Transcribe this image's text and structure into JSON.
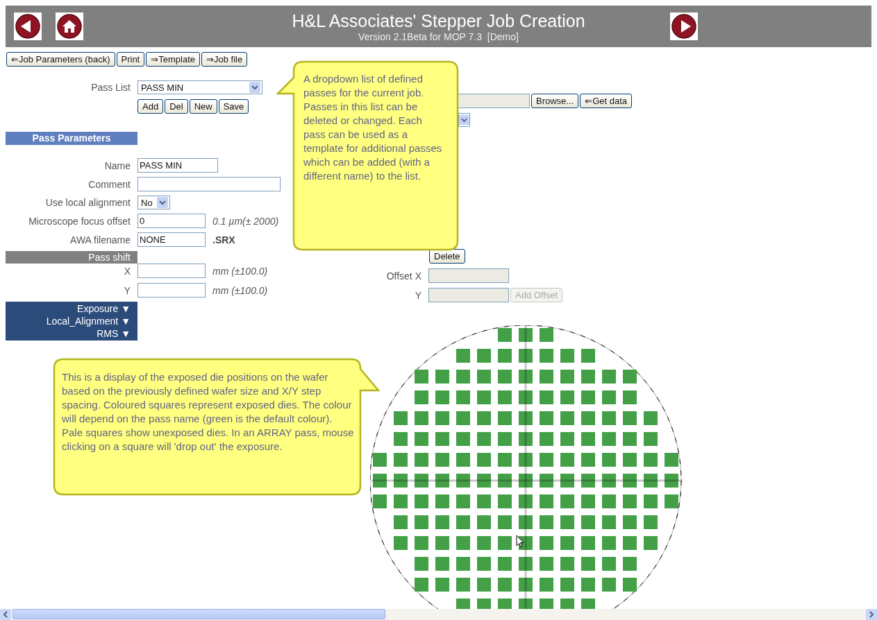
{
  "header": {
    "title": "H&L Associates' Stepper Job Creation",
    "subtitle": "Version 2.1Beta for MOP 7.3  [Demo]"
  },
  "toolbar": [
    "⇐Job Parameters (back)",
    "Print",
    "⇒Template",
    "⇒Job file"
  ],
  "pass_list": {
    "label": "Pass List",
    "value": "PASS MIN",
    "buttons": [
      "Add",
      "Del",
      "New",
      "Save"
    ]
  },
  "pass_parameters": {
    "title": "Pass Parameters",
    "fields": [
      {
        "label": "Name",
        "kind": "text",
        "value": "PASS MIN"
      },
      {
        "label": "Comment",
        "kind": "text"
      },
      {
        "label": "Use local alignment",
        "kind": "select",
        "value": "No"
      },
      {
        "label": "Microscope focus offset",
        "kind": "text",
        "value": "0",
        "unit": {
          "text": "0.1 µm(± 2000)",
          "kind": "note"
        }
      },
      {
        "label": "AWA filename",
        "kind": "text",
        "value": "NONE",
        "unit": {
          "text": ".SRX",
          "kind": "extension"
        }
      }
    ]
  },
  "pass_shift": {
    "title": "Pass shift",
    "rows": [
      {
        "label": "X",
        "unit": "mm (±100.0)"
      },
      {
        "label": "Y",
        "unit": "mm (±100.0)"
      }
    ]
  },
  "sections": [
    "Exposure ▼",
    "Local_Alignment ▼",
    "RMS ▼"
  ],
  "file_row": {
    "buttons": [
      "Browse...",
      "⇐Get data"
    ]
  },
  "delete_button": "Delete",
  "offsets": {
    "rows": [
      {
        "label": "Offset X"
      },
      {
        "label": "Y"
      }
    ],
    "add_button": {
      "label": "Add Offset",
      "disabled": true
    }
  },
  "callouts": [
    "A dropdown list of defined passes for the current job. Passes in this list can be deleted or changed. Each pass can be used as a template for additional passes which can be added (with a different name) to the list.",
    "This is a display of the exposed die positions on the wafer based on the previously defined wafer size and X/Y step spacing. Coloured squares represent exposed dies. The colour will depend on the pass name (green is the default colour). Pale squares show unexposed dies. In an ARRAY pass, mouse clicking on a square will 'drop out' the exposure."
  ]
}
